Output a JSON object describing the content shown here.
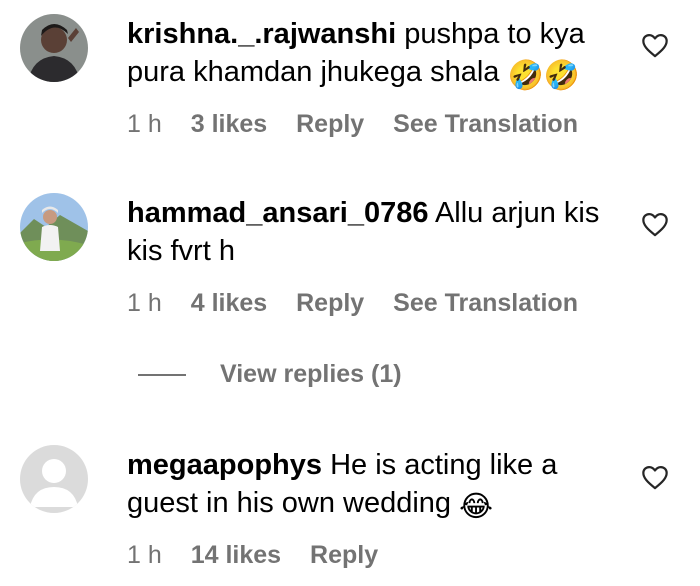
{
  "comments": [
    {
      "username": "krishna._.rajwanshi",
      "text": "pushpa to kya pura khamdan jhukega shala",
      "emoji": "🤣🤣",
      "time": "1 h",
      "likes": "3 likes",
      "reply": "Reply",
      "translation": "See Translation",
      "avatar_icon": "profile-photo-dark"
    },
    {
      "username": "hammad_ansari_0786",
      "text": "Allu arjun kis kis fvrt h",
      "time": "1 h",
      "likes": "4 likes",
      "reply": "Reply",
      "translation": "See Translation",
      "avatar_icon": "profile-photo-outdoor"
    },
    {
      "username": "megaapophys",
      "text": "He is acting like a guest in his own wedding",
      "emoji": "😂",
      "time": "1 h",
      "likes": "14 likes",
      "reply": "Reply",
      "avatar_icon": "default-avatar"
    }
  ],
  "view_replies": "View replies (1)",
  "icons": {
    "like": "heart-outline-icon"
  },
  "colors": {
    "text": "#000000",
    "meta": "#737373",
    "heart": "#262626"
  }
}
